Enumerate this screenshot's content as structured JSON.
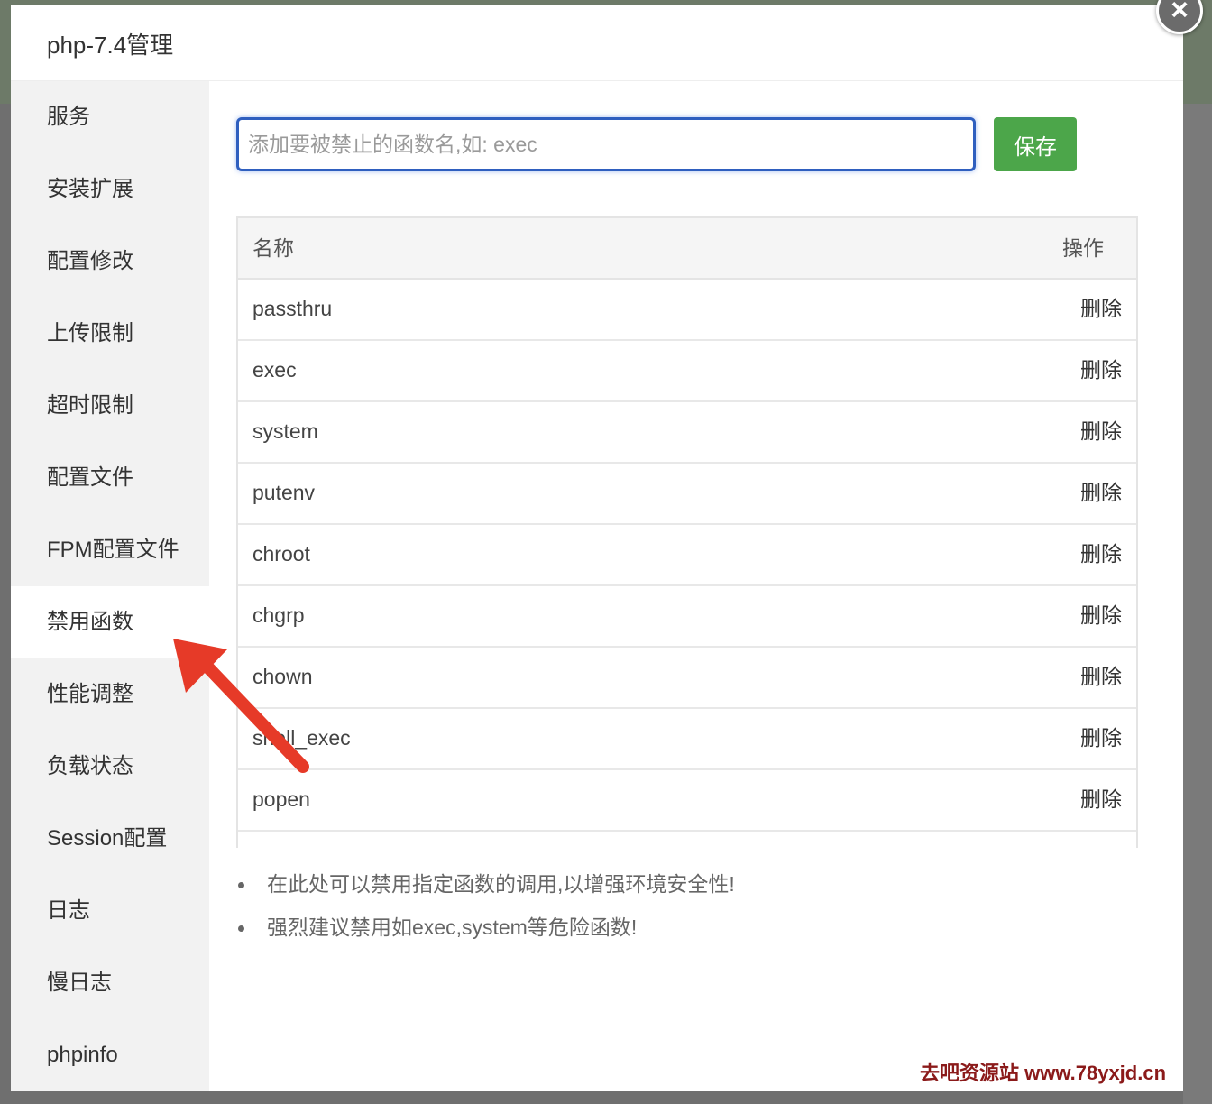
{
  "modal": {
    "title": "php-7.4管理",
    "close_glyph": "×"
  },
  "sidebar": {
    "items": [
      {
        "label": "服务"
      },
      {
        "label": "安装扩展"
      },
      {
        "label": "配置修改"
      },
      {
        "label": "上传限制"
      },
      {
        "label": "超时限制"
      },
      {
        "label": "配置文件"
      },
      {
        "label": "FPM配置文件"
      },
      {
        "label": "禁用函数"
      },
      {
        "label": "性能调整"
      },
      {
        "label": "负载状态"
      },
      {
        "label": "Session配置"
      },
      {
        "label": "日志"
      },
      {
        "label": "慢日志"
      },
      {
        "label": "phpinfo"
      }
    ],
    "active_index": 7
  },
  "form": {
    "placeholder": "添加要被禁止的函数名,如: exec",
    "value": "",
    "save_label": "保存"
  },
  "table": {
    "header_name": "名称",
    "header_op": "操作",
    "rows": [
      {
        "name": "passthru",
        "action": "删除"
      },
      {
        "name": "exec",
        "action": "删除"
      },
      {
        "name": "system",
        "action": "删除"
      },
      {
        "name": "putenv",
        "action": "删除"
      },
      {
        "name": "chroot",
        "action": "删除"
      },
      {
        "name": "chgrp",
        "action": "删除"
      },
      {
        "name": "chown",
        "action": "删除"
      },
      {
        "name": "shell_exec",
        "action": "删除"
      },
      {
        "name": "popen",
        "action": "删除"
      }
    ]
  },
  "tips": [
    "在此处可以禁用指定函数的调用,以增强环境安全性!",
    "强烈建议禁用如exec,system等危险函数!"
  ],
  "watermark": "去吧资源站  www.78yxjd.cn",
  "colors": {
    "input_border": "#2f5fbf",
    "save_button": "#4ca64a",
    "annotation_arrow": "#e63a28",
    "watermark": "#8b1a1a"
  }
}
